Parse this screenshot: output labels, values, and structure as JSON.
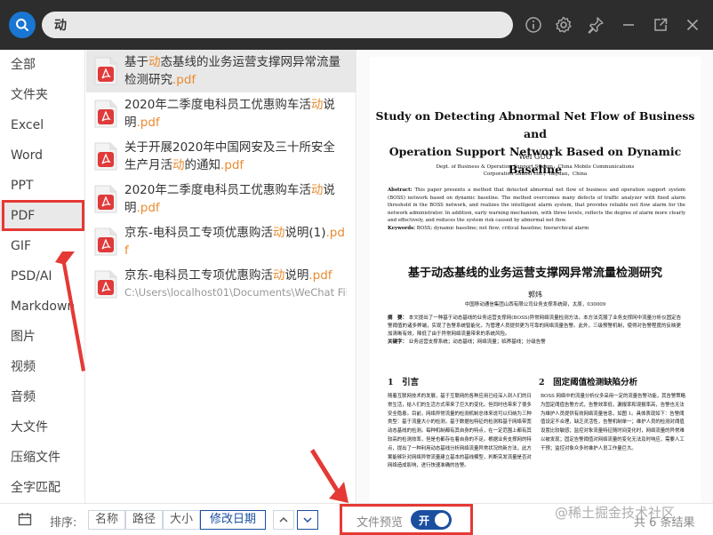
{
  "search": {
    "value": "动"
  },
  "toolbar": {
    "icons": [
      "info-icon",
      "gear-icon",
      "pin-icon",
      "minimize-icon",
      "popout-icon",
      "close-icon"
    ]
  },
  "sidebar": {
    "items": [
      {
        "label": "全部"
      },
      {
        "label": "文件夹"
      },
      {
        "label": "Excel"
      },
      {
        "label": "Word"
      },
      {
        "label": "PPT"
      },
      {
        "label": "PDF",
        "selected": true
      },
      {
        "label": "GIF"
      },
      {
        "label": "PSD/AI"
      },
      {
        "label": "Markdown"
      },
      {
        "label": "图片"
      },
      {
        "label": "视频"
      },
      {
        "label": "音频"
      },
      {
        "label": "大文件"
      },
      {
        "label": "压缩文件"
      },
      {
        "label": "全字匹配"
      }
    ]
  },
  "files": [
    {
      "parts": [
        [
          "基于",
          ""
        ],
        [
          "动",
          "hl"
        ],
        [
          "态基线的业务运营支撑网异常流量检测研究",
          ""
        ],
        [
          ".pdf",
          "ext"
        ]
      ]
    },
    {
      "parts": [
        [
          "2020年二季度电科员工优惠购车活",
          ""
        ],
        [
          "动",
          "hl"
        ],
        [
          "说明",
          ""
        ],
        [
          ".pdf",
          "ext"
        ]
      ]
    },
    {
      "parts": [
        [
          "关于开展2020年中国网安及三十所安全生产月活",
          ""
        ],
        [
          "动",
          "hl"
        ],
        [
          "的通知",
          ""
        ],
        [
          ".pdf",
          "ext"
        ]
      ]
    },
    {
      "parts": [
        [
          "2020年二季度电科员工优惠购车活",
          ""
        ],
        [
          "动",
          "hl"
        ],
        [
          "说明",
          ""
        ],
        [
          ".pdf",
          "ext"
        ]
      ]
    },
    {
      "parts": [
        [
          "京东-电科员工专项优惠购活",
          ""
        ],
        [
          "动",
          "hl"
        ],
        [
          "说明(1)",
          ""
        ],
        [
          ".pdf",
          "ext"
        ]
      ]
    },
    {
      "parts": [
        [
          "京东-电科员工专项优惠购活",
          ""
        ],
        [
          "动",
          "hl"
        ],
        [
          "说明",
          ""
        ],
        [
          ".pdf",
          "ext"
        ]
      ],
      "path": "C:\\Users\\localhost01\\Documents\\WeChat File..."
    }
  ],
  "preview_doc": {
    "en_title_1": "Study on Detecting    Abnormal Net Flow of Business and",
    "en_title_2": "Operation Support Network Based on Dynamic Baseline",
    "en_author": "Wei GUO",
    "en_aff_1": "Dept. of Business & Operation Support System，China Mobile Communications",
    "en_aff_2": "Corporation Shanxi Ltd.，Taiyuan，China",
    "abstract_label": "Abstract:",
    "abstract": "This paper presents a method that detected abnormal net flow of business and operation support system (BOSS) network based on dynamic baseline. The method overcomes many defects of traffic analyzer with fixed alarm threshold in the BOSS network, and realizes the intelligent alarm system, that provides reliable net flow alarm for the network administrator. In addition, early warning mechanism, with three levels, reflects the degree of alarm more clearly and effectively, and reduces the system risk caused by abnormal net flow.",
    "keywords_label": "Keywords:",
    "keywords": "BOSS; dynamic baseline; net flow; critical baseline; hierarchical alarm",
    "cn_title": "基于动态基线的业务运营支撑网异常流量检测研究",
    "cn_author": "郭炜",
    "cn_aff": "中国移动通信集团山西有限公司业务支撑系统部，太原，030009",
    "cn_abs_label": "摘　要：",
    "cn_abs": "本文提出了一种基于动态基线的业务运营支撑网(BOSS)异常网络流量检测方法。本方法克服了业务支撑网中流量分析仪固定告警阈值的诸多弊端，实现了告警系统智能化，为管理人员提供更为可靠的网络流量告警。此外，三级预警机制，使得对告警程度的反映更加清晰有效，降低了由于异常网络流量带来的系统风险。",
    "cn_kw_label": "关键字：",
    "cn_kw": "业务运营支撑系统；动态基线；网络流量；临界基线；分级告警",
    "sec1": "1　引言",
    "sec2": "2　固定阈值检测缺陷分析",
    "col1": "随着互联网技术的发展，基于互联网的各种应用已经深入到人们的日常生活，给人们的生活方式带来了巨大的变化。但同时也带来了很多安全隐患。目前，网络异常流量的检测机制总体来说可以归纳为三种类型：基于流量大小的检测，基于数据包特征的检测和基于网络带宽动态基线的检测。每种机制都有其自身的特点，在一定范围上都有其较高的检测效率，但是也都存在着自身的不足。根据业务支撑网的特点，提出了一种利用动态基线分析网络流量异常状况的新方法，此方案能够针对网络异常流量建立基本的基线模型，判断突发流量是否对网络造成影响，进行快速准确的告警。",
    "col2": "BOSS 网络中的流量分析仪多采用一定的流量告警功能，其告警策略为固定阈值告警方式，告警效率低，漏报率和误报率高，告警也无法为维护人员提供有效网络流量信息，如图 1。具体表现如下：告警阈值设定不合理，缺乏灵活性，告警机制单一；维护人员的检测对阈值设置比较敏感；监控对象流量特征随时间变化时，网络流量的异常难以被发现；固定告警阈值对网络流量的变化无法及时响应，需要人工干预；监控对象众多时维护人员工作量巨大。"
  },
  "bottom": {
    "sort_label": "排序:",
    "sort_options": [
      {
        "label": "名称",
        "active": false
      },
      {
        "label": "路径",
        "active": false
      },
      {
        "label": "大小",
        "active": false
      },
      {
        "label": "修改日期",
        "active": true
      }
    ],
    "preview_label": "文件预览",
    "toggle_label": "开",
    "total": "共 6 条结果"
  },
  "watermark": "@稀土掘金技术社区",
  "colors": {
    "accent": "#1a4fa0",
    "highlight": "#e98b2f",
    "annotation": "#e53935",
    "topbar": "#2d2d2d"
  }
}
